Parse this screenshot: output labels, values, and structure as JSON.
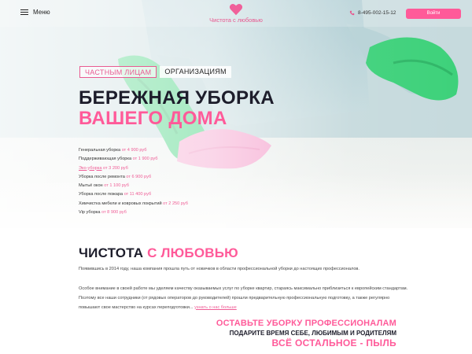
{
  "header": {
    "menu_label": "Меню",
    "logo_text": "Чистота с любовью",
    "phone": "8-495-002-15-12",
    "login_label": "Войти"
  },
  "hero": {
    "tabs": [
      {
        "label": "ЧАСТНЫМ ЛИЦАМ",
        "active": true
      },
      {
        "label": "ОРГАНИЗАЦИЯМ",
        "active": false
      }
    ],
    "title_line1": "БЕРЕЖНАЯ УБОРКА",
    "title_line2": "ВАШЕГО ДОМА",
    "services": [
      {
        "name": "Генеральная уборка",
        "price": "от 4 900 руб"
      },
      {
        "name": "Поддерживающая уборка",
        "price": "от 1 900 руб"
      },
      {
        "name": "Эко-уборка",
        "price": "от 3 200 руб"
      },
      {
        "name": "Уборка после ремонта",
        "price": "от 6 900 руб"
      },
      {
        "name": "Мытьё окон",
        "price": "от 1 100 руб"
      },
      {
        "name": "Уборка после пожара",
        "price": "от 11 400 руб"
      },
      {
        "name": "Химчистка мебели и ковровых покрытий",
        "price": "от 2 250 руб"
      },
      {
        "name": "Vip уборка",
        "price": "от 8 900 руб"
      }
    ]
  },
  "about": {
    "title_dark": "ЧИСТОТА",
    "title_pink": "С ЛЮБОВЬЮ",
    "paragraph1": "Появившись в 2014 году, наша компания прошла путь от новичков в области профессиональной уборки до настоящих профессионалов.",
    "paragraph2": "Особое внимание в своей работе мы уделяем качеству оказываемых услуг по уборке квартир, стараясь максимально приблизиться к европейским стандартам. Поэтому все наши сотрудники (от рядовых операторов до руководителей) прошли предварительную профессиональную подготовку, а также регулярно повышают свое мастерство на курсах переподготовки...",
    "more_link": "узнать о нас больше"
  },
  "slogan": {
    "line1": "ОСТАВЬТЕ УБОРКУ ПРОФЕССИОНАЛАМ",
    "line2": "ПОДАРИТЕ ВРЕМЯ СЕБЕ, ЛЮБИМЫМ И РОДИТЕЛЯМ",
    "line3": "ВСЁ ОСТАЛЬНОЕ - ПЫЛЬ"
  },
  "colors": {
    "accent": "#ff5a99",
    "dark": "#1d1d2b",
    "glove": "#3dd17a"
  },
  "icons": [
    "hamburger-icon",
    "heart-icon",
    "phone-icon"
  ]
}
